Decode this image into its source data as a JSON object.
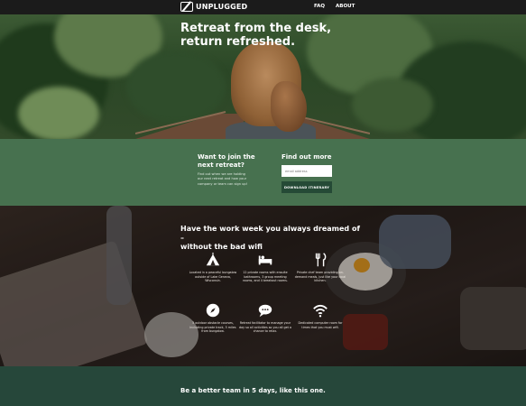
{
  "nav": {
    "brand": "UNPLUGGED",
    "links": [
      {
        "label": "FAQ"
      },
      {
        "label": "ABOUT"
      }
    ]
  },
  "hero": {
    "title_line1": "Retreat from the desk,",
    "title_line2": "return refreshed."
  },
  "signup": {
    "heading_line1": "Want to join the",
    "heading_line2": "next retreat?",
    "description": "Find out when we are holding our next retreat and how your company or team can sign up!",
    "form_heading": "Find out more",
    "email_placeholder": "email address",
    "button_label": "DOWNLOAD ITINERARY"
  },
  "features": {
    "heading_line1": "Have the work week you always dreamed of –",
    "heading_line2": "without the bad wifi",
    "items": [
      {
        "icon": "tent-icon",
        "text": "Located in a peaceful bungalow outside of Lake Geneva, Wisconsin."
      },
      {
        "icon": "bed-icon",
        "text": "12 private rooms with ensuite bathrooms, 3 group meeting rooms, and 4 breakout rooms."
      },
      {
        "icon": "utensils-icon",
        "text": "Private chef team providing on-demand meals, just like your local kitchen."
      },
      {
        "icon": "compass-icon",
        "text": "5 outdoor obstacle courses, including private track, 5 miles from bungalow."
      },
      {
        "icon": "chat-icon",
        "text": "Retreat facilitator to manage your day so all activities so you all get a chance to relax."
      },
      {
        "icon": "wifi-icon",
        "text": "Dedicated computer room for times that you must wifi."
      }
    ]
  },
  "bottom": {
    "heading": "Be a better team in 5 days, like this one."
  },
  "colors": {
    "nav_bg": "#1b1b1b",
    "signup_bg": "#47714f",
    "button_bg": "#254a36",
    "bottom_bg": "#26473a"
  }
}
